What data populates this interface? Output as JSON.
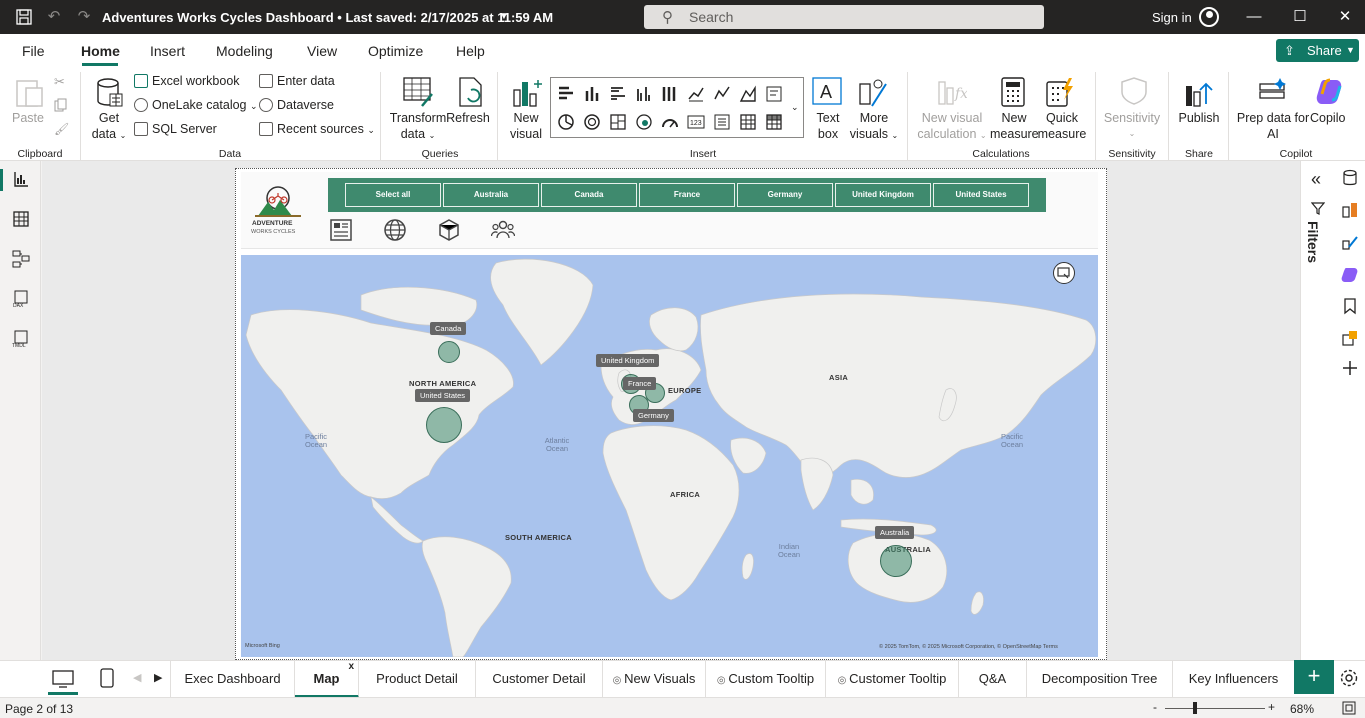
{
  "titlebar": {
    "title": "Adventures Works Cycles Dashboard • Last saved: 2/17/2025 at 11:59 AM",
    "search_placeholder": "Search",
    "signin": "Sign in"
  },
  "menu": [
    "File",
    "Home",
    "Insert",
    "Modeling",
    "View",
    "Optimize",
    "Help"
  ],
  "share_label": "Share",
  "ribbon": {
    "paste": "Paste",
    "clipboard": "Clipboard",
    "get_data": "Get",
    "get_data2": "data",
    "excel": "Excel workbook",
    "onelake": "OneLake catalog",
    "sql": "SQL Server",
    "enter_data": "Enter data",
    "dataverse": "Dataverse",
    "recent": "Recent sources",
    "data_group": "Data",
    "transform": "Transform",
    "transform2": "data",
    "refresh": "Refresh",
    "queries_group": "Queries",
    "new_visual": "New",
    "new_visual2": "visual",
    "text_box": "Text",
    "text_box2": "box",
    "more_visuals": "More",
    "more_visuals2": "visuals",
    "insert_group": "Insert",
    "new_visual_calc": "New visual",
    "new_visual_calc2": "calculation",
    "new_measure": "New",
    "new_measure2": "measure",
    "quick_measure": "Quick",
    "quick_measure2": "measure",
    "calc_group": "Calculations",
    "sensitivity": "Sensitivity",
    "sensitivity_group": "Sensitivity",
    "publish": "Publish",
    "share_group": "Share",
    "prep_ai": "Prep data for",
    "prep_ai2": "AI",
    "copilot": "Copilo",
    "copilot_group": "Copilot"
  },
  "slicer": [
    "Select all",
    "Australia",
    "Canada",
    "France",
    "Germany",
    "United Kingdom",
    "United States"
  ],
  "map": {
    "continents": [
      "NORTH AMERICA",
      "SOUTH AMERICA",
      "EUROPE",
      "AFRICA",
      "ASIA",
      "AUSTRALIA"
    ],
    "oceans": [
      "Pacific Ocean",
      "Atlantic Ocean",
      "Indian Ocean",
      "Pacific Ocean"
    ],
    "bubbles": [
      {
        "label": "Canada"
      },
      {
        "label": "United States"
      },
      {
        "label": "United Kingdom"
      },
      {
        "label": "France"
      },
      {
        "label": "Germany"
      },
      {
        "label": "Australia"
      }
    ],
    "attribution": "© 2025 TomTom, © 2025 Microsoft Corporation, © OpenStreetMap  Terms",
    "bing": "Microsoft Bing"
  },
  "filters_label": "Filters",
  "tabs": [
    "Exec Dashboard",
    "Map",
    "Product Detail",
    "Customer Detail",
    "New Visuals",
    "Custom Tooltip",
    "Customer Tooltip",
    "Q&A",
    "Decomposition Tree",
    "Key Influencers"
  ],
  "status": {
    "page": "Page 2 of 13",
    "zoom": "68%"
  }
}
